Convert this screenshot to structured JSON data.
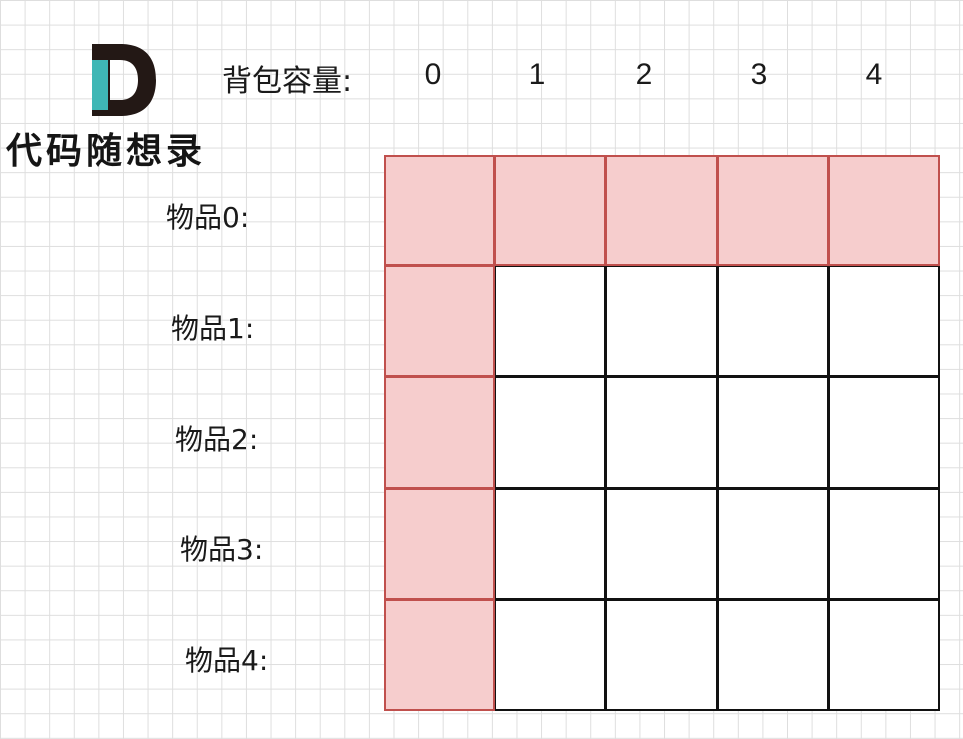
{
  "brand": {
    "logo_letter": "D",
    "name": "代码随想录"
  },
  "header": {
    "capacity_label": "背包容量:",
    "capacities": [
      "0",
      "1",
      "2",
      "3",
      "4"
    ]
  },
  "rows": {
    "labels": [
      "物品0:",
      "物品1:",
      "物品2:",
      "物品3:",
      "物品4:"
    ]
  },
  "dp_table": {
    "rows": 5,
    "cols": 5,
    "initialized": "first row and first column",
    "cell_states": [
      [
        "init",
        "init",
        "init",
        "init",
        "init"
      ],
      [
        "init",
        "empty",
        "empty",
        "empty",
        "empty"
      ],
      [
        "init",
        "empty",
        "empty",
        "empty",
        "empty"
      ],
      [
        "init",
        "empty",
        "empty",
        "empty",
        "empty"
      ],
      [
        "init",
        "empty",
        "empty",
        "empty",
        "empty"
      ]
    ]
  },
  "colors": {
    "init_fill": "#f6cdcd",
    "init_border": "#c0504d",
    "cell_border": "#111111",
    "logo_dark": "#231815",
    "logo_teal": "#3fb7b5"
  }
}
